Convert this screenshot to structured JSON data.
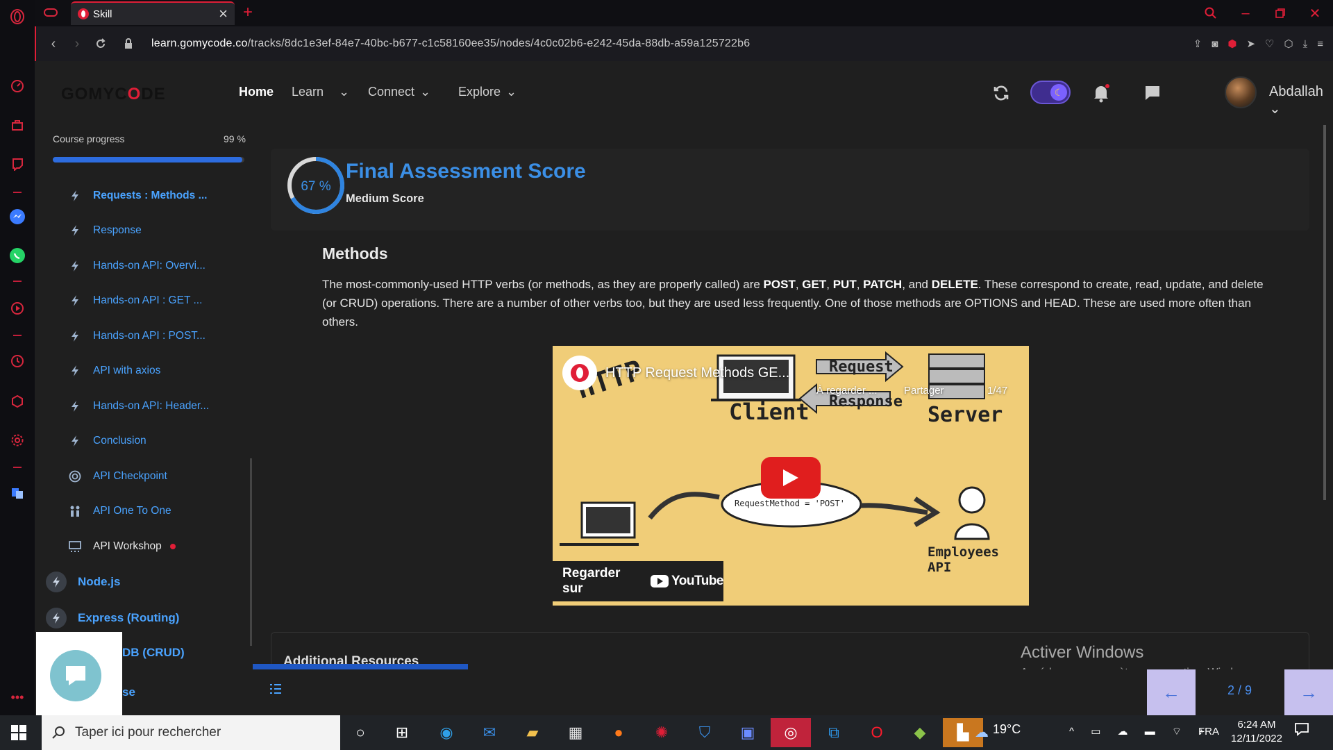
{
  "browser": {
    "tab_title": "Skill",
    "url_domain": "learn.gomycode.co",
    "url_path": "/tracks/8dc1e3ef-84e7-40bc-b677-c1c58160ee35/nodes/4c0c02b6-e242-45da-88db-a59a125722b6"
  },
  "header": {
    "logo_a": "GOMYC",
    "logo_o": "O",
    "logo_b": "DE",
    "nav": {
      "home": "Home",
      "learn": "Learn",
      "connect": "Connect",
      "explore": "Explore"
    },
    "username": "Abdallah"
  },
  "sidebar": {
    "progress_label": "Course progress",
    "progress_value": "99 %",
    "progress_fraction": 0.99,
    "lessons": [
      {
        "label": "Requests : Methods ...",
        "icon": "bolt-icon"
      },
      {
        "label": "Response",
        "icon": "bolt-icon"
      },
      {
        "label": "Hands-on API: Overvi...",
        "icon": "bolt-icon"
      },
      {
        "label": "Hands-on API : GET ...",
        "icon": "bolt-icon"
      },
      {
        "label": "Hands-on API : POST...",
        "icon": "bolt-icon"
      },
      {
        "label": "API with axios",
        "icon": "bolt-icon"
      },
      {
        "label": "Hands-on API: Header...",
        "icon": "bolt-icon"
      },
      {
        "label": "Conclusion",
        "icon": "bolt-icon"
      },
      {
        "label": "API Checkpoint",
        "icon": "target-icon"
      },
      {
        "label": "API One To One",
        "icon": "people-icon"
      },
      {
        "label": "API Workshop",
        "icon": "workshop-icon"
      }
    ],
    "modules": [
      {
        "label": "Node.js"
      },
      {
        "label": "Express (Routing)"
      }
    ],
    "partial_1": "DB (CRUD)",
    "partial_2": "se"
  },
  "main": {
    "score_percent": "67 %",
    "score_fraction": 0.67,
    "score_title": "Final Assessment Score",
    "score_subtitle": "Medium Score",
    "methods_heading": "Methods",
    "methods_p1": "The most-commonly-used HTTP verbs (or methods, as they are properly called) are ",
    "methods_b1": "POST",
    "methods_s1": ", ",
    "methods_b2": "GET",
    "methods_s2": ", ",
    "methods_b3": "PUT",
    "methods_s3": ", ",
    "methods_b4": "PATCH",
    "methods_s4": ", and ",
    "methods_b5": "DELETE",
    "methods_p2": ". These correspond to create, read, update, and delete (or CRUD) operations. There are a number of other verbs too, but they are used less frequently. One of those methods are OPTIONS and HEAD. These are used more often than others.",
    "video": {
      "title": "HTTP Request Methods GE...",
      "later": "À regarder ...",
      "share": "Partager",
      "count": "1/47",
      "watch_on": "Regarder sur",
      "yt_brand": "YouTube",
      "doodle_http": "HTTP",
      "doodle_request": "Request",
      "doodle_response": "Response",
      "doodle_client": "Client",
      "doodle_server": "Server",
      "doodle_method": "RequestMethod = 'POST'",
      "doodle_api": "Employees API"
    },
    "resources_title": "Additional Resources",
    "page_indicator": "2 / 9"
  },
  "windows": {
    "activate_title": "Activer Windows",
    "activate_sub": "Accédez aux paramètres pour activer Windows.",
    "search_placeholder": "Taper ici pour rechercher",
    "weather": "19°C",
    "lang": "FRA",
    "time": "6:24 AM",
    "date": "12/11/2022"
  },
  "colors": {
    "accent": "#3b8fe6",
    "brand_red": "#e01e37",
    "link": "#4aa3ff"
  }
}
